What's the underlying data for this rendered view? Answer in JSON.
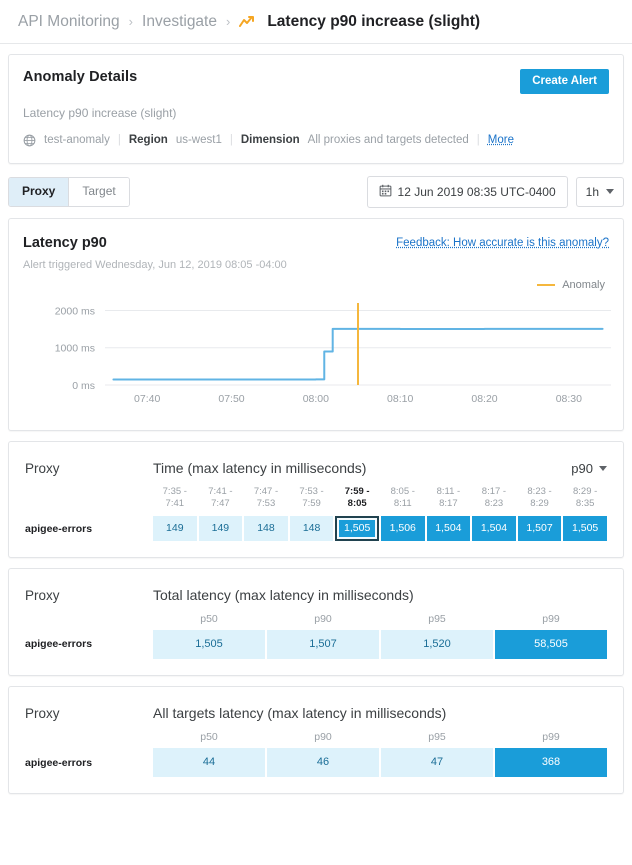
{
  "breadcrumb": {
    "root": "API Monitoring",
    "section": "Investigate",
    "current": "Latency p90 increase (slight)",
    "separator": "›",
    "trend_icon": "trend-up-icon"
  },
  "anomaly_details": {
    "title": "Anomaly Details",
    "create_alert_label": "Create Alert",
    "subtitle": "Latency p90 increase (slight)",
    "org": "test-anomaly",
    "org_icon": "globe-icon",
    "region_label": "Region",
    "region_value": "us-west1",
    "dimension_label": "Dimension",
    "dimension_value": "All proxies and targets detected",
    "more_label": "More"
  },
  "toolbar": {
    "segments": [
      {
        "label": "Proxy",
        "active": true
      },
      {
        "label": "Target",
        "active": false
      }
    ],
    "date_icon": "calendar-icon",
    "date_value": "12 Jun 2019 08:35 UTC-0400",
    "range_value": "1h",
    "range_caret": "chevron-down-icon"
  },
  "chart_card": {
    "title": "Latency p90",
    "feedback_link": "Feedback: How accurate is this anomaly?",
    "alert_triggered": "Alert triggered Wednesday, Jun 12, 2019 08:05 -04:00",
    "legend_label": "Anomaly"
  },
  "chart_data": {
    "type": "line",
    "title": "Latency p90",
    "xlabel": "",
    "ylabel": "",
    "ylim": [
      0,
      2200
    ],
    "yticks": [
      0,
      1000,
      2000
    ],
    "ytick_labels": [
      "0 ms",
      "1000 ms",
      "2000 ms"
    ],
    "xticks": [
      "07:40",
      "07:50",
      "08:00",
      "08:10",
      "08:20",
      "08:30"
    ],
    "xlim": [
      "07:35",
      "08:35"
    ],
    "grid": true,
    "legend_position": "top-right",
    "series": [
      {
        "name": "Latency p90",
        "color": "#61b4e4",
        "x": [
          "07:36",
          "07:38",
          "07:40",
          "07:42",
          "07:44",
          "07:46",
          "07:48",
          "07:50",
          "07:52",
          "07:54",
          "07:56",
          "07:58",
          "08:00",
          "08:01",
          "08:02",
          "08:04",
          "08:06",
          "08:08",
          "08:10",
          "08:12",
          "08:14",
          "08:16",
          "08:18",
          "08:20",
          "08:22",
          "08:24",
          "08:26",
          "08:28",
          "08:30",
          "08:32",
          "08:34"
        ],
        "values": [
          149,
          149,
          149,
          149,
          149,
          148,
          148,
          148,
          148,
          148,
          148,
          148,
          150,
          900,
          1505,
          1505,
          1506,
          1506,
          1504,
          1504,
          1504,
          1504,
          1504,
          1507,
          1507,
          1505,
          1505,
          1505,
          1505,
          1505,
          1505
        ]
      }
    ],
    "annotations": [
      {
        "type": "vline",
        "name": "anomaly-marker",
        "x": "08:05",
        "color": "#f5b73d",
        "label": "Anomaly"
      }
    ]
  },
  "time_table": {
    "proxy_label": "Proxy",
    "caption": "Time (max latency in milliseconds)",
    "unit": "p90",
    "unit_caret": "chevron-down-icon",
    "columns": [
      {
        "top": "7:35 -",
        "bottom": "7:41",
        "bold": false
      },
      {
        "top": "7:41 -",
        "bottom": "7:47",
        "bold": false
      },
      {
        "top": "7:47 -",
        "bottom": "7:53",
        "bold": false
      },
      {
        "top": "7:53 -",
        "bottom": "7:59",
        "bold": false
      },
      {
        "top": "7:59 -",
        "bottom": "8:05",
        "bold": true
      },
      {
        "top": "8:05 -",
        "bottom": "8:11",
        "bold": false
      },
      {
        "top": "8:11 -",
        "bottom": "8:17",
        "bold": false
      },
      {
        "top": "8:17 -",
        "bottom": "8:23",
        "bold": false
      },
      {
        "top": "8:23 -",
        "bottom": "8:29",
        "bold": false
      },
      {
        "top": "8:29 -",
        "bottom": "8:35",
        "bold": false
      }
    ],
    "rows": [
      {
        "label": "apigee-errors",
        "cells": [
          {
            "value": "149",
            "tone": "light",
            "selected": false
          },
          {
            "value": "149",
            "tone": "light",
            "selected": false
          },
          {
            "value": "148",
            "tone": "light",
            "selected": false
          },
          {
            "value": "148",
            "tone": "light",
            "selected": false
          },
          {
            "value": "1,505",
            "tone": "dark",
            "selected": true
          },
          {
            "value": "1,506",
            "tone": "dark",
            "selected": false
          },
          {
            "value": "1,504",
            "tone": "dark",
            "selected": false
          },
          {
            "value": "1,504",
            "tone": "dark",
            "selected": false
          },
          {
            "value": "1,507",
            "tone": "dark",
            "selected": false
          },
          {
            "value": "1,505",
            "tone": "dark",
            "selected": false
          }
        ]
      }
    ]
  },
  "total_latency_table": {
    "proxy_label": "Proxy",
    "caption": "Total latency (max latency in milliseconds)",
    "columns": [
      "p50",
      "p90",
      "p95",
      "p99"
    ],
    "rows": [
      {
        "label": "apigee-errors",
        "cells": [
          {
            "value": "1,505",
            "tone": "light"
          },
          {
            "value": "1,507",
            "tone": "light"
          },
          {
            "value": "1,520",
            "tone": "light"
          },
          {
            "value": "58,505",
            "tone": "dark"
          }
        ]
      }
    ]
  },
  "targets_latency_table": {
    "proxy_label": "Proxy",
    "caption": "All targets latency (max latency in milliseconds)",
    "columns": [
      "p50",
      "p90",
      "p95",
      "p99"
    ],
    "rows": [
      {
        "label": "apigee-errors",
        "cells": [
          {
            "value": "44",
            "tone": "light"
          },
          {
            "value": "46",
            "tone": "light"
          },
          {
            "value": "47",
            "tone": "light"
          },
          {
            "value": "368",
            "tone": "dark"
          }
        ]
      }
    ]
  },
  "colors": {
    "accent_blue": "#1a9dd9",
    "cell_light": "#ddf2fb",
    "cell_dark": "#1a9dd9",
    "anomaly_orange": "#f5b73d",
    "series_blue": "#61b4e4",
    "link_blue": "#1a73c9"
  }
}
